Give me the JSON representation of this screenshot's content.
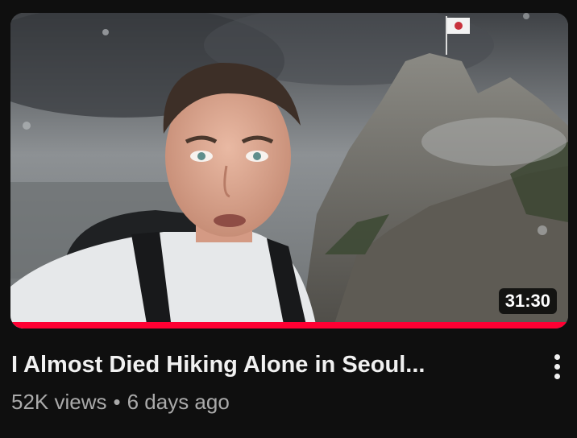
{
  "video": {
    "title": "I Almost Died Hiking Alone in Seoul...",
    "duration": "31:30",
    "views": "52K views",
    "separator": "•",
    "published": "6 days ago",
    "watched_fraction": 1.0,
    "progress_color": "#ff0033"
  },
  "menu": {
    "icon": "more-vert-icon"
  }
}
